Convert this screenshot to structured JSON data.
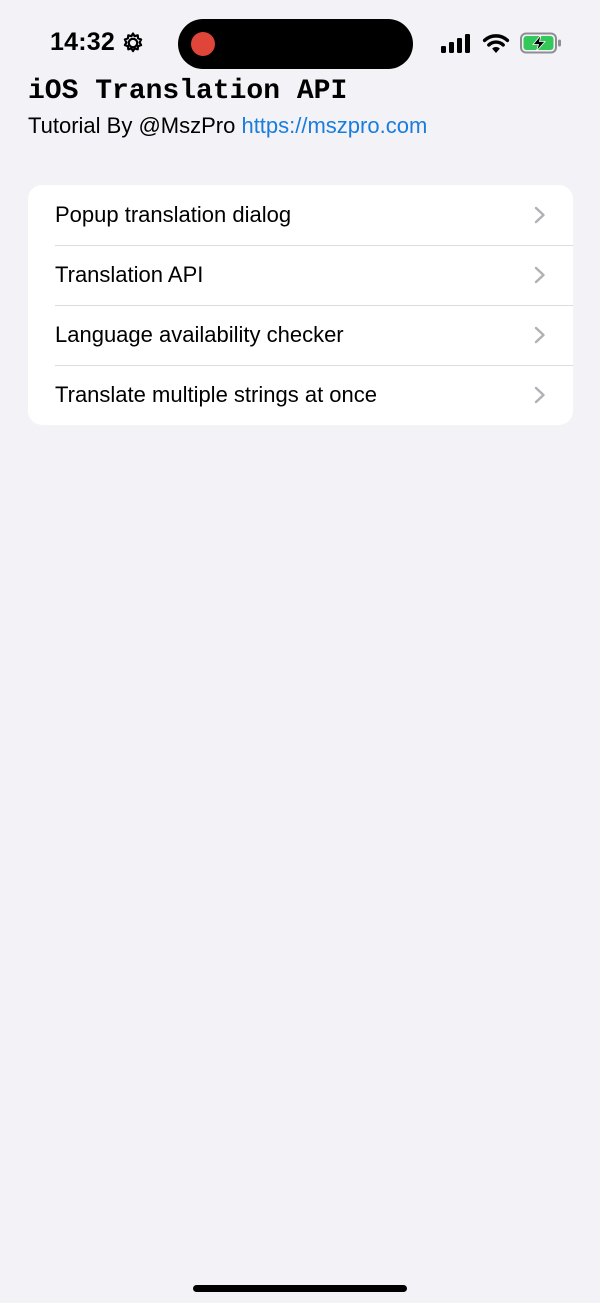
{
  "status_bar": {
    "time": "14:32",
    "recording_color": "#e0453a",
    "battery_color": "#34c759"
  },
  "header": {
    "title": "iOS Translation API",
    "subtitle_prefix": "Tutorial By @MszPro ",
    "subtitle_link": "https://mszpro.com",
    "link_color": "#1a7ddc"
  },
  "menu": {
    "items": [
      {
        "label": "Popup translation dialog"
      },
      {
        "label": "Translation API"
      },
      {
        "label": "Language availability checker"
      },
      {
        "label": "Translate multiple strings at once"
      }
    ]
  },
  "icons": {
    "status_left": "gear-icon",
    "status_right": [
      "cellular-signal-icon",
      "wifi-icon",
      "battery-charging-icon"
    ],
    "row_accessory": "chevron-right-icon"
  }
}
